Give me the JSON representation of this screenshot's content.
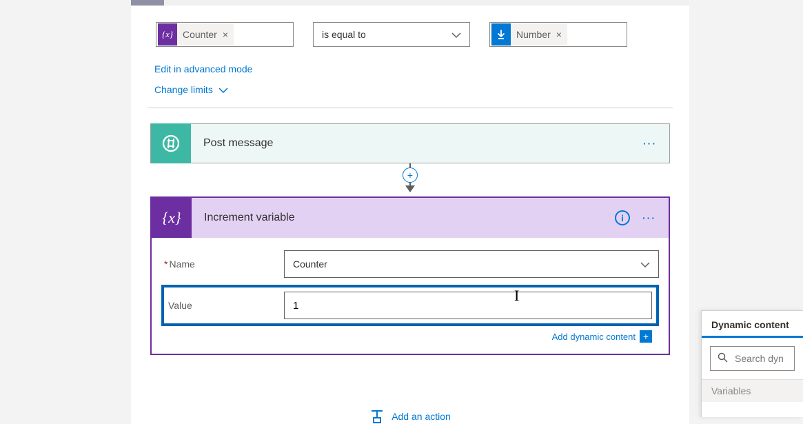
{
  "condition": {
    "left_token": {
      "icon_text": "{x}",
      "label": "Counter"
    },
    "operator": "is equal to",
    "right_token": {
      "label": "Number"
    },
    "edit_link": "Edit in advanced mode",
    "change_limits": "Change limits"
  },
  "post_message": {
    "title": "Post message"
  },
  "increment": {
    "header_icon": "{x}",
    "title": "Increment variable",
    "name_label": "Name",
    "name_value": "Counter",
    "value_label": "Value",
    "value_value": "1",
    "add_dynamic": "Add dynamic content"
  },
  "add_action": "Add an action",
  "dyn_panel": {
    "tab": "Dynamic content",
    "search_placeholder": "Search dyn",
    "category": "Variables"
  }
}
